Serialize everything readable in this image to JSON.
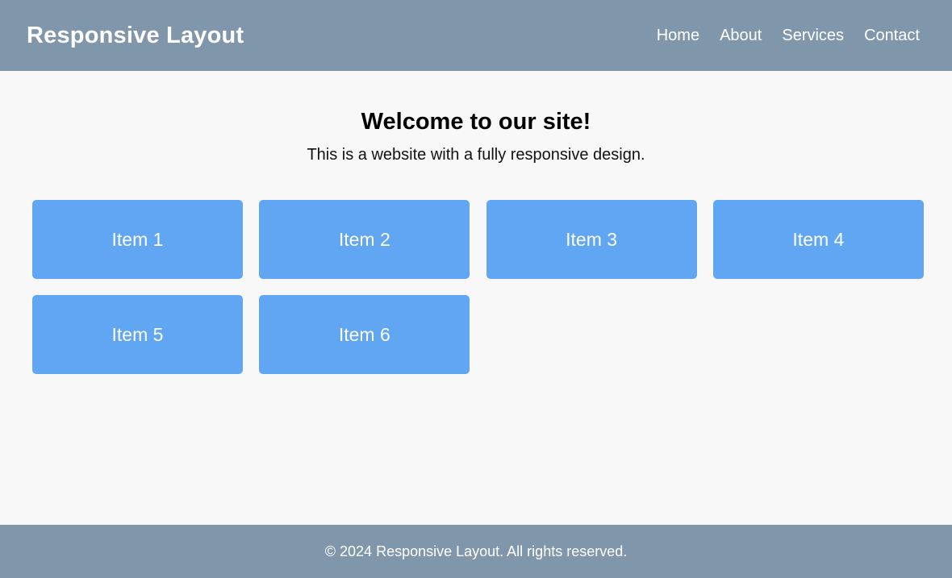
{
  "header": {
    "brand": "Responsive Layout",
    "nav": [
      "Home",
      "About",
      "Services",
      "Contact"
    ]
  },
  "main": {
    "title": "Welcome to our site!",
    "subtitle": "This is a website with a fully responsive design.",
    "items": [
      "Item 1",
      "Item 2",
      "Item 3",
      "Item 4",
      "Item 5",
      "Item 6"
    ]
  },
  "footer": {
    "text": "© 2024 Responsive Layout. All rights reserved."
  },
  "colors": {
    "header_bg": "#8097ab",
    "page_bg": "#f8f8f8",
    "card_bg": "#60a6f2",
    "footer_bg": "#8097ab"
  }
}
